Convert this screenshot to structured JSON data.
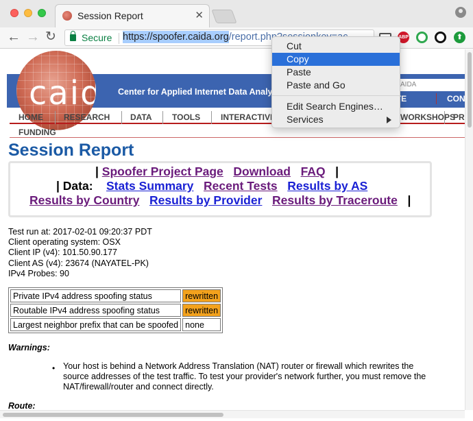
{
  "browser": {
    "tab_title": "Session Report",
    "tab_close": "✕",
    "secure_label": "Secure",
    "url_selected": "https://spoofer.caida.org",
    "url_rest": "/report.php?sessionkey=ac",
    "nav": {
      "back": "←",
      "forward": "→",
      "reload": "↻"
    },
    "extensions": {
      "abp": "ABP",
      "up": "⬆"
    }
  },
  "context_menu": {
    "items": [
      "Cut",
      "Copy",
      "Paste",
      "Paste and Go",
      "Edit Search Engines…",
      "Services"
    ],
    "active_item": "Copy"
  },
  "site": {
    "logo_text": "caida",
    "tagline": "Center for Applied Internet Data Analysis",
    "search_placeholder": "AIDA",
    "header_links": [
      "ATE",
      "CON"
    ],
    "menu": [
      "HOME",
      "RESEARCH",
      "DATA",
      "TOOLS",
      "INTERACTIVE",
      "WORKSHOPS",
      "PR"
    ],
    "menu_second_row": "FUNDING"
  },
  "report": {
    "title": "Session Report",
    "links_row1": [
      "Spoofer Project Page",
      "Download",
      "FAQ"
    ],
    "data_label": "Data:",
    "links_row2": [
      "Stats Summary",
      "Recent Tests",
      "Results by AS"
    ],
    "links_row3": [
      "Results by Country",
      "Results by Provider",
      "Results by Traceroute"
    ],
    "separator": "|",
    "info": [
      "Test run at: 2017-02-01 09:20:37 PDT",
      "Client operating system: OSX",
      "Client IP (v4): 101.50.90.177",
      "Client AS (v4): 23674 (NAYATEL-PK)",
      "IPv4 Probes: 90"
    ],
    "status_rows": [
      {
        "label": "Private IPv4 address spoofing status",
        "value": "rewritten"
      },
      {
        "label": "Routable IPv4 address spoofing status",
        "value": "rewritten"
      },
      {
        "label": "Largest neighbor prefix that can be spoofed",
        "value": "none"
      }
    ],
    "warnings_heading": "Warnings:",
    "warning_text": "Your host is behind a Network Address Translation (NAT) router or firewall which rewrites the source addresses of the test traffic. To test your provider's network further, you must remove the NAT/firewall/router and connect directly.",
    "route_heading": "Route:"
  },
  "colors": {
    "banner": "#3c64b0",
    "title": "#1b5aa5",
    "link_visited": "#6a1b7b",
    "link": "#1a21d4",
    "badge": "#f3a21d",
    "menu_highlight": "#2a70d9"
  }
}
